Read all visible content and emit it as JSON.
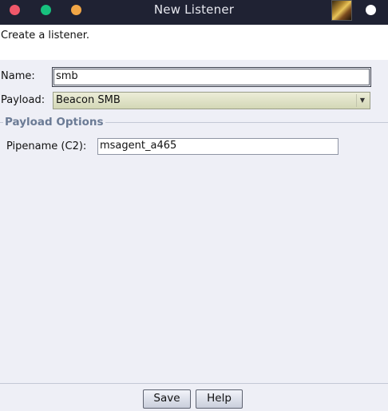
{
  "window": {
    "title": "New Listener"
  },
  "description": "Create a listener.",
  "form": {
    "name_label": "Name:",
    "name_value": "smb",
    "payload_label": "Payload:",
    "payload_value": "Beacon SMB"
  },
  "options": {
    "section_title": "Payload Options",
    "pipename_label": "Pipename (C2):",
    "pipename_value": "msagent_a465"
  },
  "buttons": {
    "save": "Save",
    "help": "Help"
  },
  "colors": {
    "titlebar": "#1f2233",
    "close": "#f0586a",
    "zoom": "#17c17e",
    "minimize": "#f1a646",
    "section_title": "#6b7b95"
  }
}
